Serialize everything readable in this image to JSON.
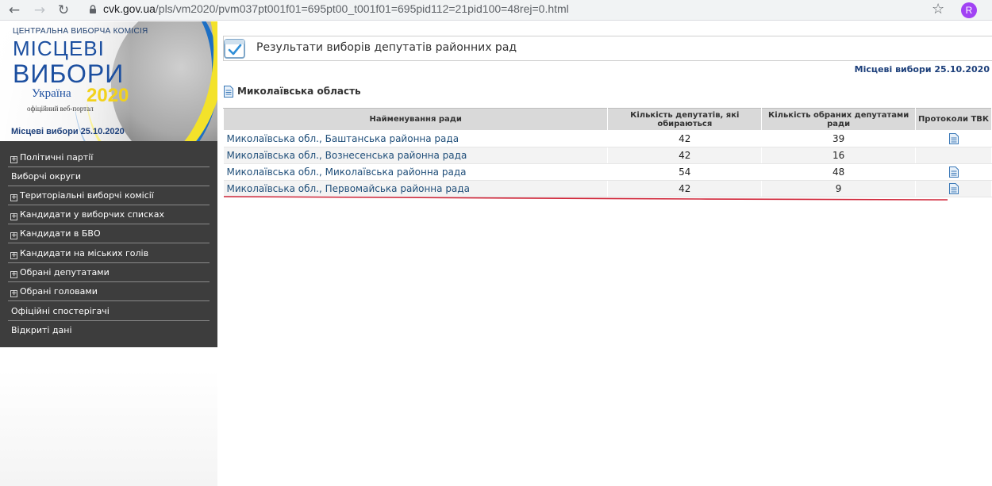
{
  "browser": {
    "url_host": "cvk.gov.ua",
    "url_path": "/pls/vm2020/pvm037pt001f01=695pt00_t001f01=695pid112=21pid100=48rej=0.html",
    "profile_initial": "R"
  },
  "banner": {
    "organization": "ЦЕНТРАЛЬНА ВИБОРЧА КОМІСІЯ",
    "title_line1": "МІСЦЕВІ",
    "title_line2": "ВИБОРИ",
    "country": "Україна",
    "year": "2020",
    "portal": "офіційний веб-портал",
    "date_label": "Місцеві вибори 25.10.2020"
  },
  "sidebar": {
    "items": [
      {
        "label": "Політичні партії",
        "expandable": true
      },
      {
        "label": "Виборчі округи",
        "expandable": false
      },
      {
        "label": "Територіальні виборчі комісії",
        "expandable": true
      },
      {
        "label": "Кандидати у виборчих списках",
        "expandable": true
      },
      {
        "label": "Кандидати в БВО",
        "expandable": true
      },
      {
        "label": "Кандидати на міських голів",
        "expandable": true
      },
      {
        "label": "Обрані депутатами",
        "expandable": true
      },
      {
        "label": "Обрані головами",
        "expandable": true
      },
      {
        "label": "Офіційні спостерігачі",
        "expandable": false
      },
      {
        "label": "Відкриті дані",
        "expandable": false
      }
    ]
  },
  "main": {
    "page_title": "Результати виборів депутатів районних рад",
    "election_date": "Місцеві вибори 25.10.2020",
    "region": "Миколаївська область",
    "table": {
      "headers": {
        "name": "Найменування ради",
        "seats": "Кількість депутатів, які обираються",
        "elected": "Кількість обраних депутатами ради",
        "protocols": "Протоколи ТВК"
      },
      "rows": [
        {
          "name": "Миколаївська обл., Баштанська районна рада",
          "seats": "42",
          "elected": "39",
          "has_protocol": true
        },
        {
          "name": "Миколаївська обл., Вознесенська районна рада",
          "seats": "42",
          "elected": "16",
          "has_protocol": false
        },
        {
          "name": "Миколаївська обл., Миколаївська районна рада",
          "seats": "54",
          "elected": "48",
          "has_protocol": true
        },
        {
          "name": "Миколаївська обл., Первомайська районна рада",
          "seats": "42",
          "elected": "9",
          "has_protocol": true
        }
      ]
    }
  },
  "colors": {
    "menu_bg": "#3d3d3d",
    "link": "#1f4e79",
    "accent_blue": "#1c4fa0",
    "accent_yellow": "#f2d21c",
    "annotation_red": "#d0273a"
  },
  "icons": [
    "back-arrow-icon",
    "forward-arrow-icon",
    "reload-icon",
    "lock-icon",
    "star-icon",
    "checkbox-icon",
    "document-icon"
  ]
}
